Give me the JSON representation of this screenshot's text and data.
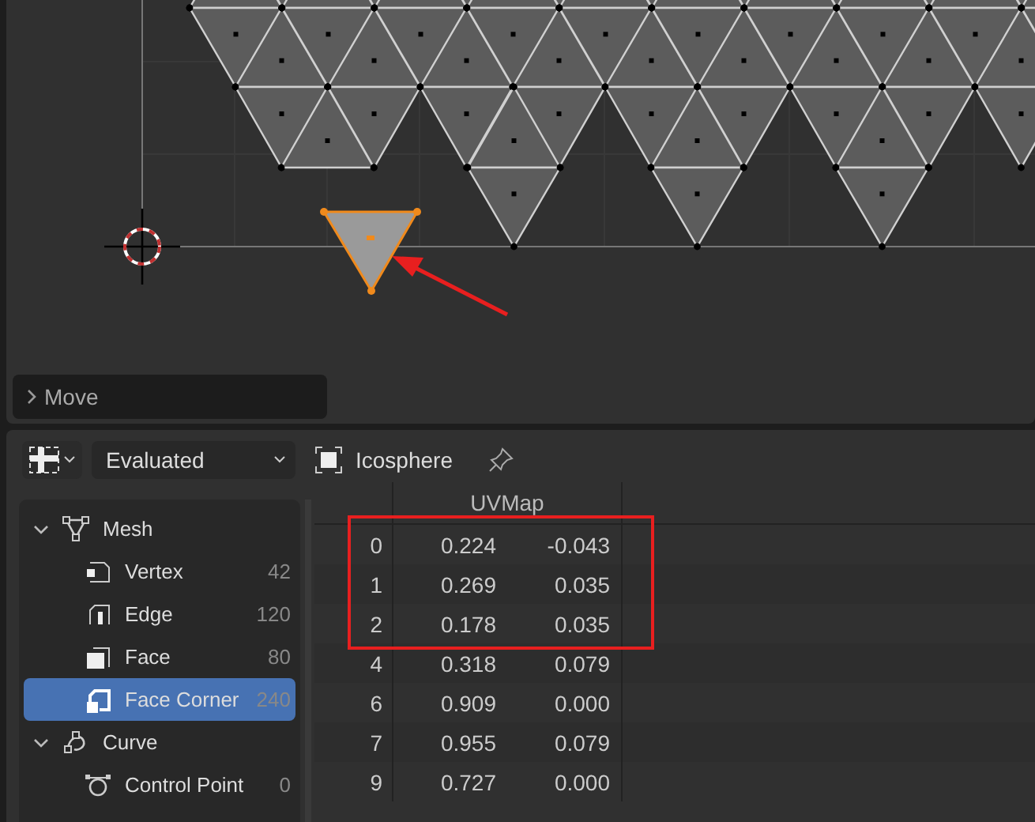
{
  "uv_editor": {
    "redo_panel": {
      "label": "Move",
      "expanded": false
    }
  },
  "spreadsheet": {
    "header": {
      "evaluation_mode": "Evaluated",
      "object_name": "Icosphere"
    },
    "tree": [
      {
        "label": "Mesh",
        "kind": "mesh",
        "expanded": true,
        "children": [
          {
            "label": "Vertex",
            "kind": "vertex",
            "count": "42",
            "selected": false
          },
          {
            "label": "Edge",
            "kind": "edge",
            "count": "120",
            "selected": false
          },
          {
            "label": "Face",
            "kind": "face",
            "count": "80",
            "selected": false
          },
          {
            "label": "Face Corner",
            "kind": "corner",
            "count": "240",
            "selected": true
          }
        ]
      },
      {
        "label": "Curve",
        "kind": "curve",
        "expanded": true,
        "children": [
          {
            "label": "Control Point",
            "kind": "point",
            "count": "0",
            "selected": false
          }
        ]
      }
    ],
    "table": {
      "columns": [
        "UVMap"
      ],
      "rows": [
        {
          "index": "0",
          "values": [
            "0.224",
            "-0.043"
          ],
          "annotated": true
        },
        {
          "index": "1",
          "values": [
            "0.269",
            "0.035"
          ],
          "annotated": true
        },
        {
          "index": "2",
          "values": [
            "0.178",
            "0.035"
          ],
          "annotated": true
        },
        {
          "index": "4",
          "values": [
            "0.318",
            "0.079"
          ],
          "annotated": false
        },
        {
          "index": "6",
          "values": [
            "0.909",
            "0.000"
          ],
          "annotated": false
        },
        {
          "index": "7",
          "values": [
            "0.955",
            "0.079"
          ],
          "annotated": false
        },
        {
          "index": "9",
          "values": [
            "0.727",
            "0.000"
          ],
          "annotated": false
        }
      ]
    }
  }
}
